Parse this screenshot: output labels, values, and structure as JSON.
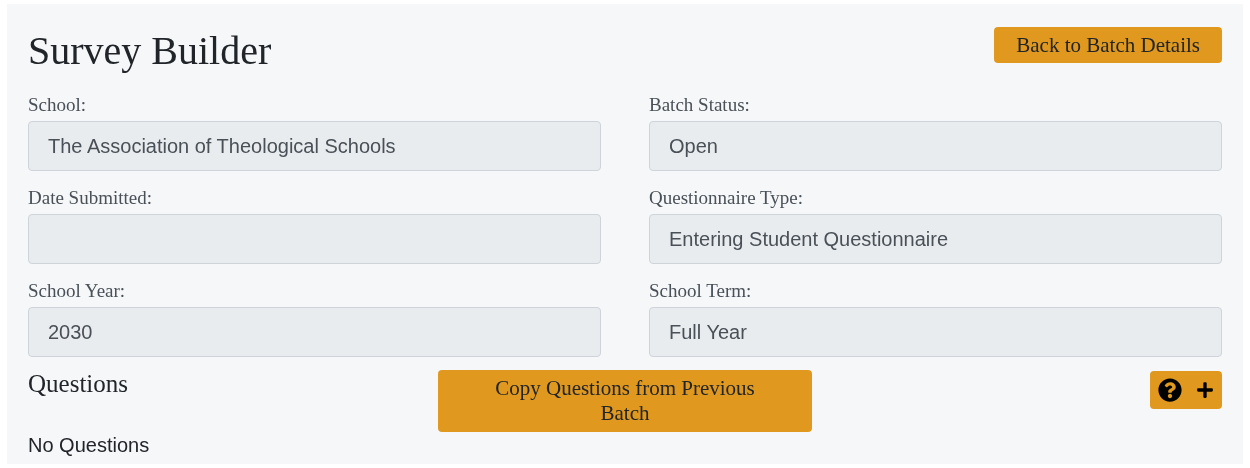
{
  "title": "Survey Builder",
  "back_button": "Back to Batch Details",
  "fields": [
    {
      "label": "School:",
      "value": "The Association of Theological Schools"
    },
    {
      "label": "Batch Status:",
      "value": "Open"
    },
    {
      "label": "Date Submitted:"
    },
    {
      "label": "Questionnaire Type:",
      "value": "Entering Student Questionnaire"
    },
    {
      "label": "School Year:",
      "value": "2030"
    },
    {
      "label": "School Term:",
      "value": "Full Year"
    }
  ],
  "questions": {
    "heading": "Questions",
    "copy_button": "Copy Questions from Previous Batch",
    "empty_text": "No Questions"
  }
}
